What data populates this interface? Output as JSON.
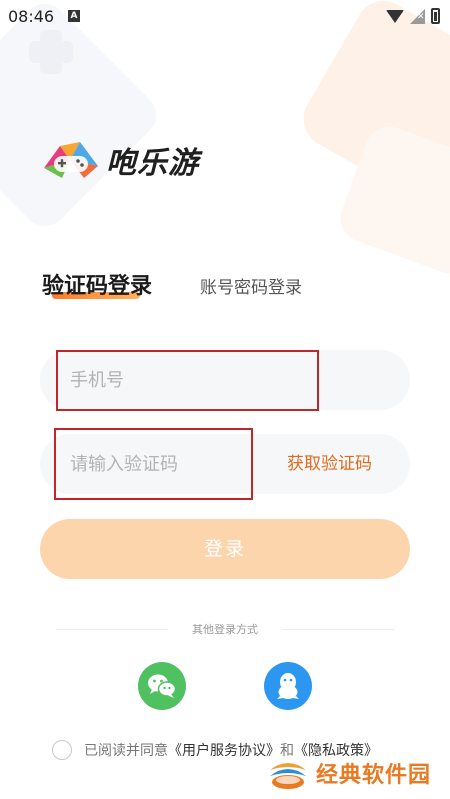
{
  "status_bar": {
    "time": "08:46",
    "notification_icon_letter": "A",
    "icons": [
      "wifi-icon",
      "signal-icon",
      "battery-icon"
    ]
  },
  "brand": {
    "name": "咆乐游",
    "colors": [
      "#e93a7c",
      "#f9a532",
      "#4fa9e8",
      "#6cc04a"
    ]
  },
  "tabs": {
    "active_label": "验证码登录",
    "inactive_label": "账号密码登录"
  },
  "form": {
    "phone_placeholder": "手机号",
    "phone_value": "",
    "code_placeholder": "请输入验证码",
    "code_value": "",
    "get_code_label": "获取验证码"
  },
  "login_button": {
    "label": "登录",
    "color": "#fdd5ad"
  },
  "other_login": {
    "label": "其他登录方式",
    "methods": [
      "wechat-icon",
      "qq-icon"
    ]
  },
  "agreement": {
    "prefix": "已阅读并同意",
    "user_agreement": "《用户服务协议》",
    "and": "和",
    "privacy_policy": "《隐私政策》"
  },
  "watermark": {
    "text": "经典软件园"
  },
  "accent_color": "#e06a1e"
}
